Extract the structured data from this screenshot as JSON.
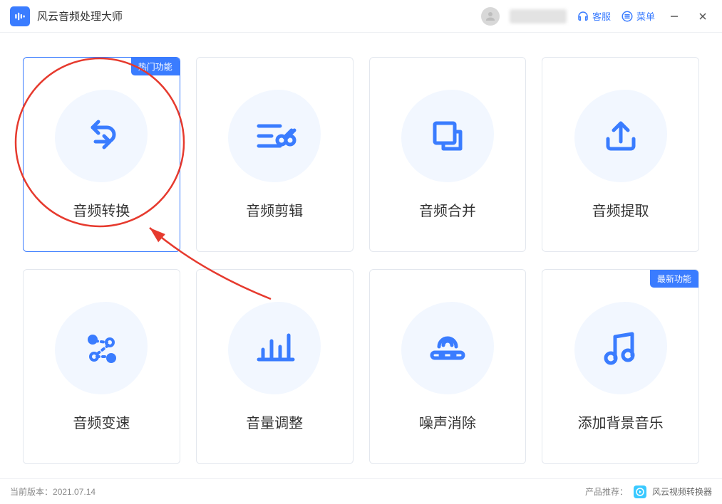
{
  "app": {
    "title": "风云音频处理大师"
  },
  "titlebar": {
    "support_label": "客服",
    "menu_label": "菜单"
  },
  "cards": [
    {
      "label": "音频转换",
      "tag": "热门功能"
    },
    {
      "label": "音频剪辑"
    },
    {
      "label": "音频合并"
    },
    {
      "label": "音频提取"
    },
    {
      "label": "音频变速"
    },
    {
      "label": "音量调整"
    },
    {
      "label": "噪声消除"
    },
    {
      "label": "添加背景音乐",
      "tag": "最新功能"
    }
  ],
  "footer": {
    "version_label": "当前版本：",
    "version_value": "2021.07.14",
    "recommend_label": "产品推荐：",
    "recommend_product": "风云视频转换器"
  },
  "colors": {
    "accent": "#3a7cff",
    "blob_bg": "#f2f7ff"
  }
}
